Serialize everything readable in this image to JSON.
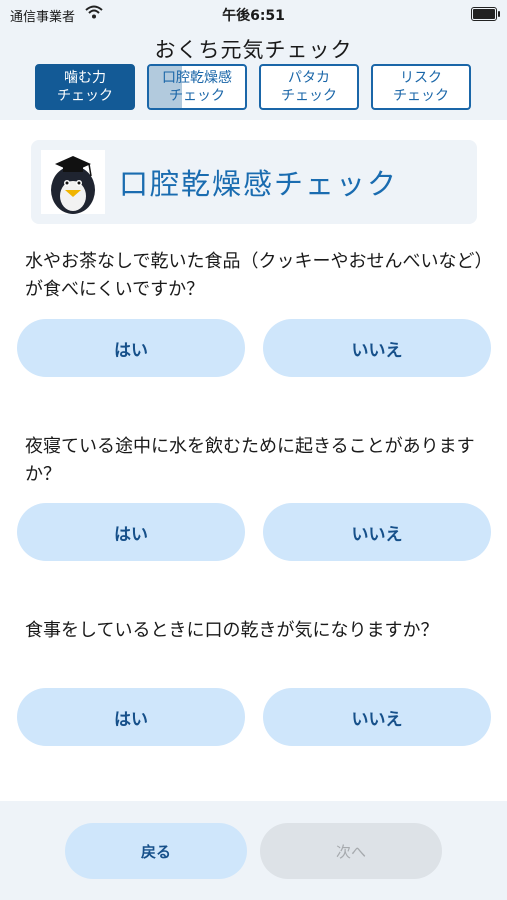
{
  "status_bar": {
    "carrier": "通信事業者",
    "time": "午後6:51"
  },
  "header": {
    "title": "おくち元気チェック",
    "tabs": [
      {
        "label": "噛む力\nチェック",
        "state": "completed"
      },
      {
        "label": "口腔乾燥感\nチェック",
        "state": "current"
      },
      {
        "label": "パタカ\nチェック",
        "state": "pending"
      },
      {
        "label": "リスク\nチェック",
        "state": "pending"
      }
    ]
  },
  "section": {
    "title": "口腔乾燥感チェック",
    "mascot_icon": "penguin-mascot-icon"
  },
  "questions": [
    {
      "text": "水やお茶なしで乾いた食品（クッキーやおせんべいなど）が食べにくいですか？",
      "yes": "はい",
      "no": "いいえ"
    },
    {
      "text": "夜寝ている途中に水を飲むために起きることがありますか？",
      "yes": "はい",
      "no": "いいえ"
    },
    {
      "text": "食事をしているときに口の乾きが気になりますか？",
      "yes": "はい",
      "no": "いいえ"
    }
  ],
  "footer": {
    "back_label": "戻る",
    "next_label": "次へ",
    "next_enabled": false
  },
  "colors": {
    "accent": "#135a96",
    "button_bg": "#cfe6fb",
    "title_blue": "#1a6cb0",
    "header_bg": "#eef3f8"
  }
}
